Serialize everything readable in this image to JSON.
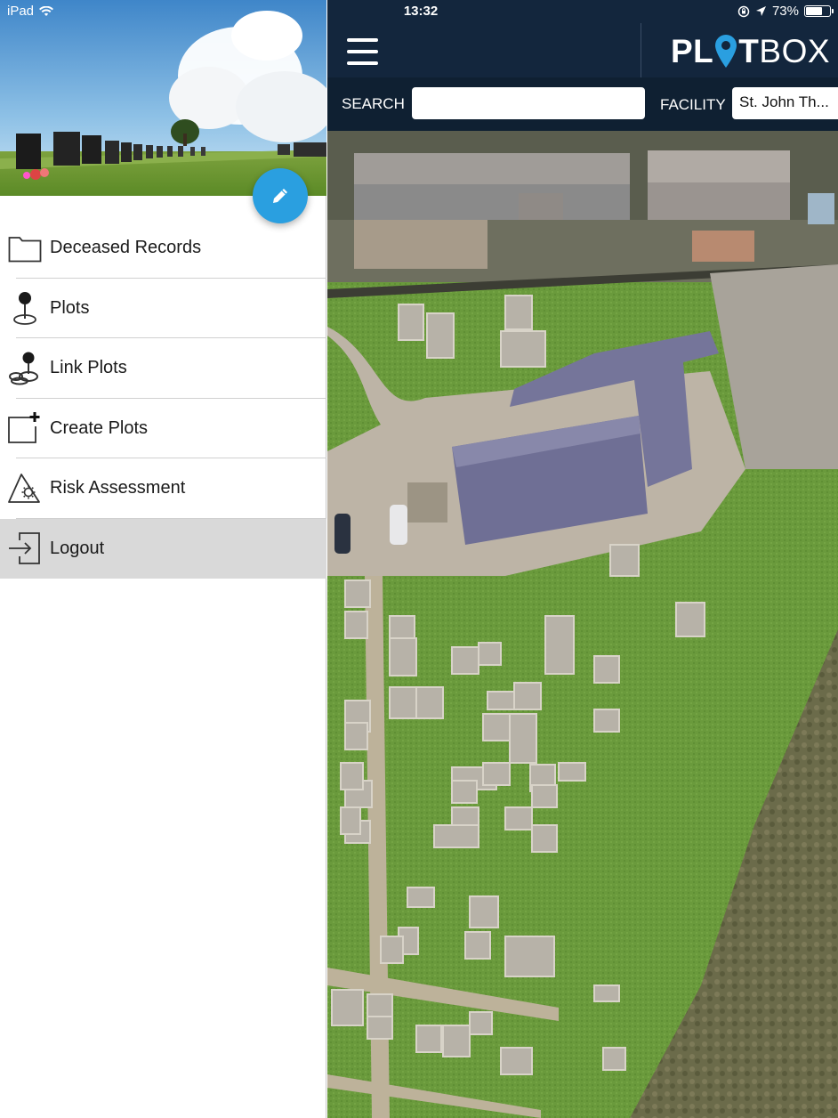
{
  "status_bar": {
    "device": "iPad",
    "time": "13:32",
    "battery_text": "73%",
    "battery_level": 0.73
  },
  "drawer": {
    "menu": [
      {
        "label": "Deceased Records",
        "icon": "folder-icon"
      },
      {
        "label": "Plots",
        "icon": "map-pin-icon"
      },
      {
        "label": "Link Plots",
        "icon": "link-plots-icon"
      },
      {
        "label": "Create Plots",
        "icon": "create-plot-icon"
      },
      {
        "label": "Risk Assessment",
        "icon": "risk-assessment-icon"
      },
      {
        "label": "Logout",
        "icon": "logout-icon",
        "active": true
      }
    ],
    "edit_icon": "pencil-icon"
  },
  "header": {
    "logo_bold": "PL",
    "logo_mid": "T",
    "logo_light": "BOX",
    "search_label": "SEARCH",
    "search_value": "",
    "facility_label": "FACILITY",
    "facility_value": "St. John Th..."
  },
  "colors": {
    "topbar": "#13263d",
    "searchbar": "#0f2032",
    "accent": "#2a9fe0",
    "active_menu": "#d9d9d9"
  }
}
